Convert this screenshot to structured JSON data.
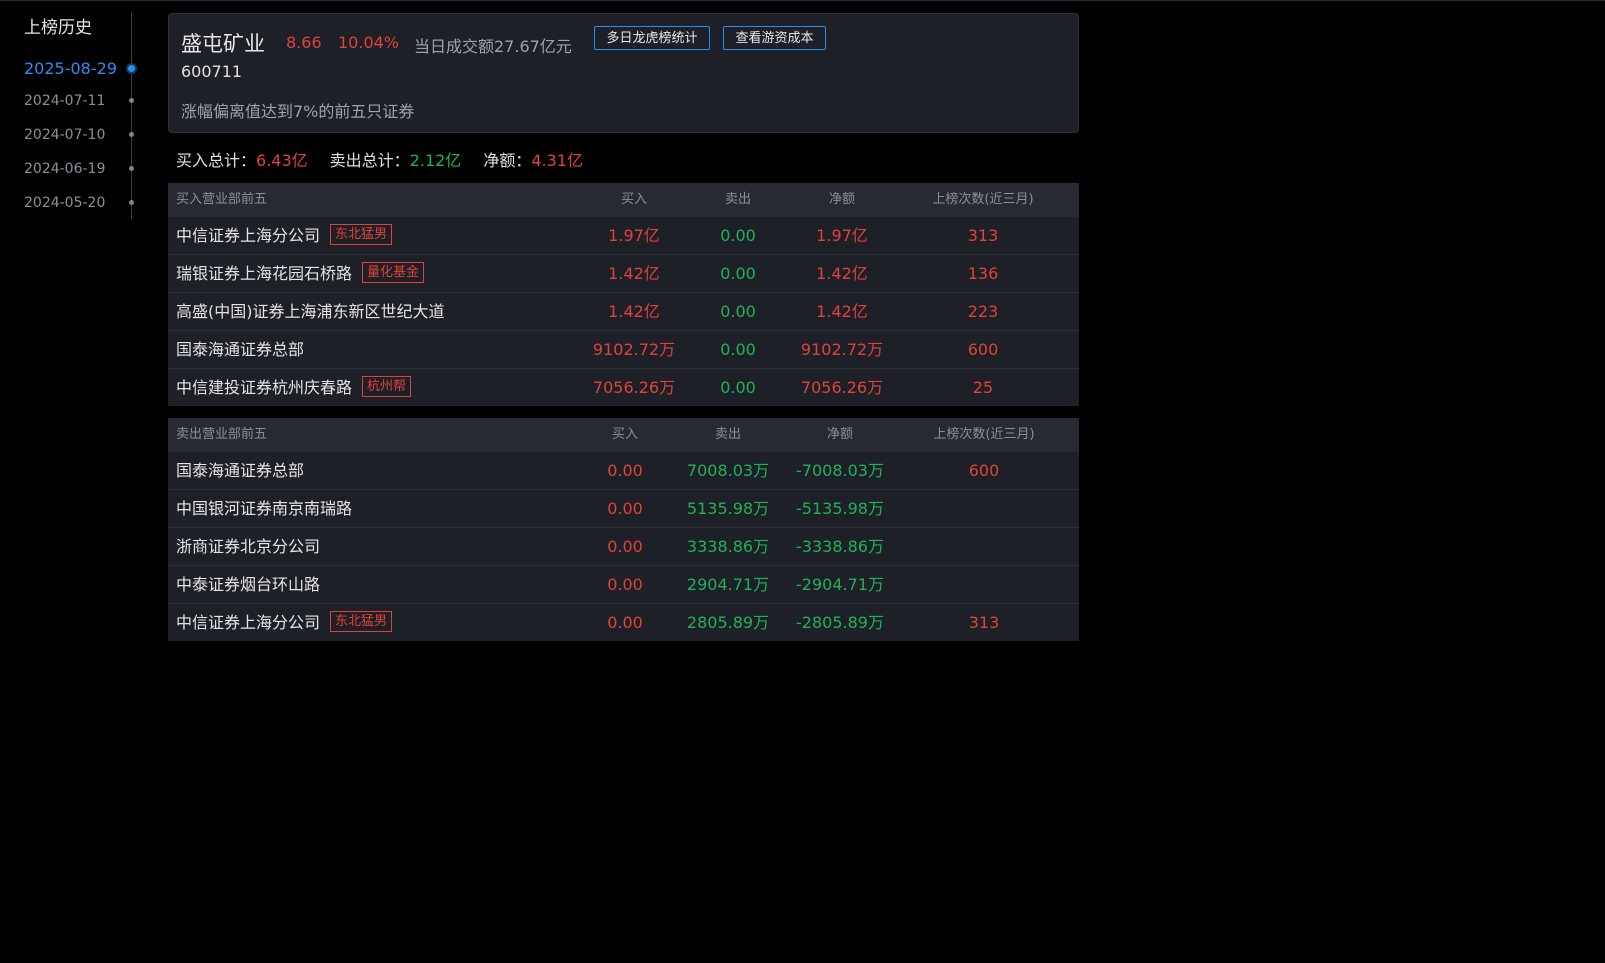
{
  "sidebar": {
    "title": "上榜历史",
    "dates": [
      {
        "label": "2025-08-29",
        "active": true
      },
      {
        "label": "2024-07-11",
        "active": false
      },
      {
        "label": "2024-07-10",
        "active": false
      },
      {
        "label": "2024-06-19",
        "active": false
      },
      {
        "label": "2024-05-20",
        "active": false
      }
    ]
  },
  "header": {
    "name": "盛屯矿业",
    "price": "8.66",
    "change": "10.04%",
    "turnover": "当日成交额27.67亿元",
    "btn_multi": "多日龙虎榜统计",
    "btn_cost": "查看游资成本",
    "code": "600711",
    "reason": "涨幅偏离值达到7%的前五只证券"
  },
  "totals": {
    "buy_label": "买入总计：",
    "buy_value": "6.43亿",
    "sell_label": "卖出总计：",
    "sell_value": "2.12亿",
    "net_label": "净额：",
    "net_value": "4.31亿"
  },
  "buy_table": {
    "headers": {
      "name": "买入营业部前五",
      "buy": "买入",
      "sell": "卖出",
      "net": "净额",
      "count": "上榜次数(近三月)"
    },
    "rows": [
      {
        "name": "中信证券上海分公司",
        "tag": "东北猛男",
        "buy": "1.97亿",
        "sell": "0.00",
        "net": "1.97亿",
        "count": "313"
      },
      {
        "name": "瑞银证券上海花园石桥路",
        "tag": "量化基金",
        "buy": "1.42亿",
        "sell": "0.00",
        "net": "1.42亿",
        "count": "136"
      },
      {
        "name": "高盛(中国)证券上海浦东新区世纪大道",
        "tag": "",
        "buy": "1.42亿",
        "sell": "0.00",
        "net": "1.42亿",
        "count": "223"
      },
      {
        "name": "国泰海通证券总部",
        "tag": "",
        "buy": "9102.72万",
        "sell": "0.00",
        "net": "9102.72万",
        "count": "600"
      },
      {
        "name": "中信建投证券杭州庆春路",
        "tag": "杭州帮",
        "buy": "7056.26万",
        "sell": "0.00",
        "net": "7056.26万",
        "count": "25"
      }
    ]
  },
  "sell_table": {
    "headers": {
      "name": "卖出营业部前五",
      "buy": "买入",
      "sell": "卖出",
      "net": "净额",
      "count": "上榜次数(近三月)"
    },
    "rows": [
      {
        "name": "国泰海通证券总部",
        "tag": "",
        "buy": "0.00",
        "sell": "7008.03万",
        "net": "-7008.03万",
        "count": "600"
      },
      {
        "name": "中国银河证券南京南瑞路",
        "tag": "",
        "buy": "0.00",
        "sell": "5135.98万",
        "net": "-5135.98万",
        "count": ""
      },
      {
        "name": "浙商证券北京分公司",
        "tag": "",
        "buy": "0.00",
        "sell": "3338.86万",
        "net": "-3338.86万",
        "count": ""
      },
      {
        "name": "中泰证券烟台环山路",
        "tag": "",
        "buy": "0.00",
        "sell": "2904.71万",
        "net": "-2904.71万",
        "count": ""
      },
      {
        "name": "中信证券上海分公司",
        "tag": "东北猛男",
        "buy": "0.00",
        "sell": "2805.89万",
        "net": "-2805.89万",
        "count": "313"
      }
    ]
  },
  "colors": {
    "accent": "#2d8cf0",
    "up": "#e0413c",
    "down": "#1fb15b",
    "background": "#000000",
    "panel": "#1d2026"
  }
}
